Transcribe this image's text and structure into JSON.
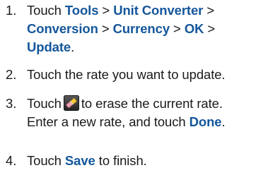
{
  "steps": [
    {
      "number": "1.",
      "t1": "Touch ",
      "k1": "Tools",
      "sep1": " > ",
      "k2": "Unit Converter",
      "sep2": " >",
      "k3": "Conversion",
      "sep3": " > ",
      "k4": "Currency",
      "sep4": " > ",
      "k5": "OK",
      "sep5": " >",
      "k6": "Update",
      "end": "."
    },
    {
      "number": "2.",
      "text": "Touch the rate you want to update."
    },
    {
      "number": "3.",
      "before_icon": "Touch",
      "icon": "eraser-icon",
      "after_icon": "to erase the current rate.",
      "line2_prefix": "Enter a new rate, and touch ",
      "k1": "Done",
      "end": "."
    },
    {
      "number": "4.",
      "prefix": "Touch ",
      "k1": "Save",
      "suffix": " to finish."
    }
  ],
  "colors": {
    "text": "#1a1a1a",
    "keyword": "#14569b",
    "icon_bg_top": "#5a5a5a",
    "icon_bg_bottom": "#222222",
    "eraser_pink": "#f2a2b0",
    "eraser_yellow": "#f3c739"
  }
}
